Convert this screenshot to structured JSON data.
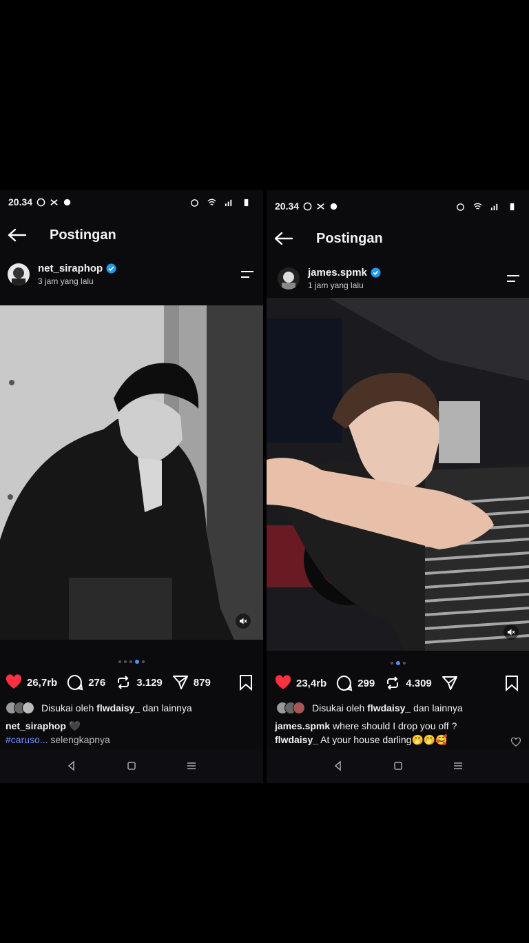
{
  "left": {
    "status": {
      "time": "20.34"
    },
    "title": "Postingan",
    "user": {
      "name": "net_siraphop",
      "time": "3 jam yang lalu"
    },
    "stats": {
      "likes": "26,7rb",
      "comments": "276",
      "reposts": "3.129",
      "shares": "879"
    },
    "liked_by": {
      "prefix": "Disukai oleh ",
      "user": "flwdaisy_",
      "suffix": " dan lainnya"
    },
    "caption": {
      "user": "net_siraphop",
      "emoji": "🖤",
      "tag": "#caruso...",
      "more": " selengkapnya"
    },
    "carousel": {
      "count": 5,
      "active": 4
    }
  },
  "right": {
    "status": {
      "time": "20.34"
    },
    "title": "Postingan",
    "user": {
      "name": "james.spmk",
      "time": "1 jam yang lalu"
    },
    "stats": {
      "likes": "23,4rb",
      "comments": "299",
      "reposts": "4.309"
    },
    "liked_by": {
      "prefix": "Disukai oleh ",
      "user": "flwdaisy_",
      "suffix": " dan lainnya"
    },
    "caption": {
      "user": "james.spmk",
      "text": " where should I drop you off ?"
    },
    "comment": {
      "user": "flwdaisy_",
      "text": " At your house darling🤭🤭🥰"
    },
    "carousel": {
      "count": 3,
      "active": 2
    }
  },
  "colors": {
    "like_red": "#ff3040",
    "verified_blue": "#1d9bf0",
    "tag_blue": "#6b8cff"
  }
}
